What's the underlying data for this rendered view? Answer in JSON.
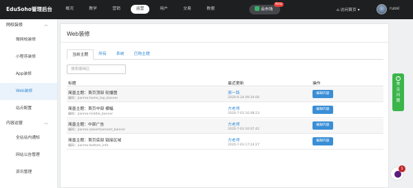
{
  "header": {
    "brand": "EduSoho管理后台",
    "nav": [
      "概况",
      "教学",
      "营销",
      "运营",
      "用户",
      "交易",
      "数据"
    ],
    "active_nav": "运营",
    "cloud_market": "云市场",
    "cloud_badge": "New",
    "visit_home": "访问首页",
    "username": "ruoxi"
  },
  "sidebar": {
    "groups": [
      {
        "title": "网校装修",
        "items": [
          "微网校装修",
          "小程序装修",
          "App装修",
          "Web装修",
          "站点配置"
        ],
        "active": "Web装修"
      },
      {
        "title": "内容运营",
        "items": [
          "全站站内通知",
          "网站公告管理",
          "资讯管理"
        ]
      }
    ]
  },
  "main": {
    "title": "Web装修",
    "tabs": [
      "当前主题",
      "所有",
      "系统",
      "已购主题"
    ],
    "active_tab": "当前主题",
    "search_placeholder": "搜索编辑区",
    "columns": {
      "title": "标题",
      "updated": "最近更新",
      "actions": "操作"
    },
    "rows": [
      {
        "name": "简墨主题：首页顶部 轮播图",
        "code": "编码：jianmo:home_top_banner",
        "editor": "邢一跃",
        "time": "2020-6-24 09:34:06",
        "button": "编辑内容"
      },
      {
        "name": "简墨主题：首页中部 横幅",
        "code": "编码：jianmo:middle_banner",
        "editor": "方老师",
        "time": "2020-7-03 16:08:23",
        "button": "编辑内容"
      },
      {
        "name": "简墨主题：中部广告",
        "code": "编码：jianmo:advertisement_banner",
        "editor": "方老师",
        "time": "2020-7-03 16:07:42",
        "button": "编辑内容"
      },
      {
        "name": "简墨主题：首页底部 链接区域",
        "code": "编码：jianmo:bottom_info",
        "editor": "方老师",
        "time": "2020-7-03 17:24:27",
        "button": "编辑内容"
      }
    ]
  },
  "float_help": {
    "text": "常见问题"
  },
  "notification": {
    "count": "1"
  },
  "colors": {
    "accent": "#2f88d4",
    "button": "#3a8ed6",
    "help": "#3ab54a",
    "topbar": "#1d1f21"
  }
}
